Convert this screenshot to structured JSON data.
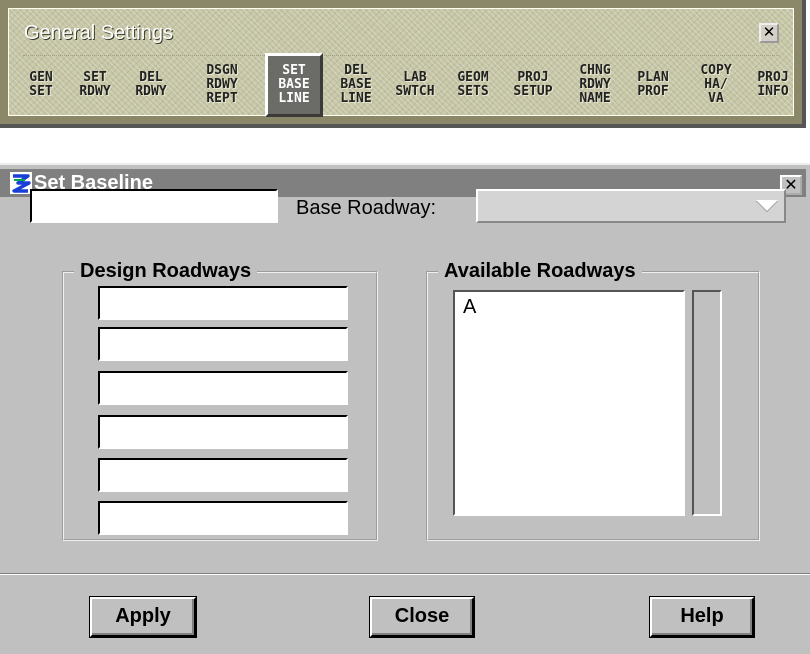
{
  "toolbar": {
    "title": "General Settings",
    "close_glyph": "✕",
    "buttons": [
      {
        "label": "GEN\nSET"
      },
      {
        "label": "SET\nRDWY"
      },
      {
        "label": "DEL\nRDWY"
      },
      {
        "label": "DSGN\nRDWY\nREPT"
      },
      {
        "label": "SET\nBASE\nLINE",
        "active": true
      },
      {
        "label": "DEL\nBASE\nLINE"
      },
      {
        "label": "LAB\nSWTCH"
      },
      {
        "label": "GEOM\nSETS"
      },
      {
        "label": "PROJ\nSETUP"
      },
      {
        "label": "CHNG\nRDWY\nNAME"
      },
      {
        "label": "PLAN\nPROF"
      },
      {
        "label": "COPY\nHA/\nVA"
      },
      {
        "label": "PROJ\nINFO"
      }
    ]
  },
  "dialog": {
    "title": "Set Baseline",
    "icon": "app-logo-icon",
    "close_glyph": "✕",
    "name_field_value": "",
    "base_roadway_label": "Base Roadway:",
    "base_roadway_value": "",
    "design_roadways": {
      "legend": "Design Roadways",
      "inputs": [
        "",
        "",
        "",
        "",
        "",
        ""
      ]
    },
    "available_roadways": {
      "legend": "Available Roadways",
      "items": [
        "A"
      ]
    },
    "buttons": {
      "apply": "Apply",
      "close": "Close",
      "help": "Help"
    }
  },
  "colors": {
    "toolbar_bg": "#c6c6a6",
    "dialog_bg": "#c0c0c0",
    "title_bar": "#808080"
  }
}
